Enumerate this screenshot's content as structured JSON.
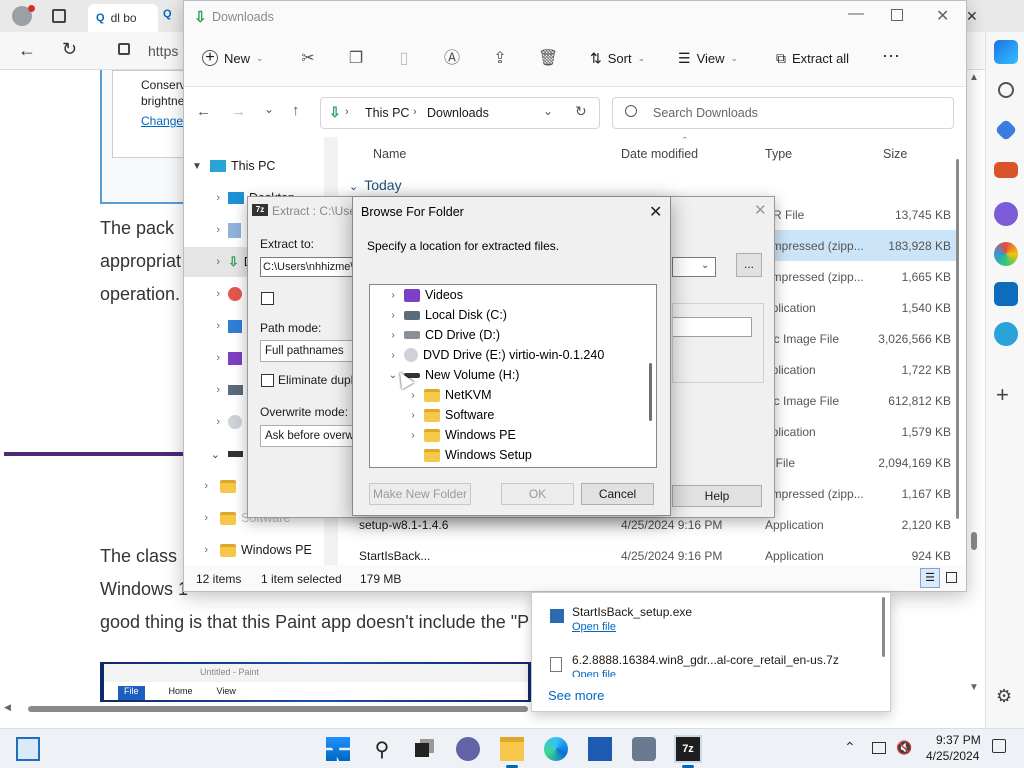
{
  "browser": {
    "tabs": [
      {
        "label": "dl bo"
      }
    ],
    "address": "https",
    "article": {
      "snippet_line1": "Conserv",
      "snippet_line2": "brightne",
      "snippet_link": "Change",
      "p1_line1": "The pack",
      "p1_line2": "appropriat",
      "p1_line3": "operation.",
      "p2_line1": "The class",
      "p2_line2": "Windows 1",
      "p2_line3": "good thing is that this Paint app doesn't include the \"P",
      "paint_title": "Untitled - Paint",
      "paint_tabs": [
        "File",
        "Home",
        "View"
      ]
    }
  },
  "explorer": {
    "title": "Downloads",
    "toolbar": {
      "new": "New",
      "sort": "Sort",
      "view": "View",
      "extract_all": "Extract all"
    },
    "breadcrumb": [
      "This PC",
      "Downloads"
    ],
    "search_placeholder": "Search Downloads",
    "nav": [
      {
        "label": "This PC"
      },
      {
        "label": "Desktop"
      },
      {
        "label": "D"
      },
      {
        "label": "D"
      },
      {
        "label": "M"
      },
      {
        "label": "P"
      },
      {
        "label": "V"
      },
      {
        "label": "L"
      },
      {
        "label": "D"
      },
      {
        "label": "N"
      },
      {
        "label": ""
      },
      {
        "label": "Software"
      },
      {
        "label": "Windows PE"
      }
    ],
    "columns": {
      "name": "Name",
      "date": "Date modified",
      "type": "Type",
      "size": "Size"
    },
    "group": "Today",
    "files": [
      {
        "name": "",
        "date": "",
        "type": "AR File",
        "size": "13,745 KB"
      },
      {
        "name": "",
        "date": "",
        "type": "ompressed (zipp...",
        "size": "183,928 KB"
      },
      {
        "name": "",
        "date": "",
        "type": "ompressed (zipp...",
        "size": "1,665 KB"
      },
      {
        "name": "",
        "date": "",
        "type": "pplication",
        "size": "1,540 KB"
      },
      {
        "name": "",
        "date": "",
        "type": "isc Image File",
        "size": "3,026,566 KB"
      },
      {
        "name": "",
        "date": "",
        "type": "pplication",
        "size": "1,722 KB"
      },
      {
        "name": "",
        "date": "",
        "type": "isc Image File",
        "size": "612,812 KB"
      },
      {
        "name": "",
        "date": "",
        "type": "pplication",
        "size": "1,579 KB"
      },
      {
        "name": "",
        "date": "",
        "type": "Z File",
        "size": "2,094,169 KB"
      },
      {
        "name": "",
        "date": "",
        "type": "ompressed (zipp...",
        "size": "1,167 KB"
      },
      {
        "name": "setup-w8.1-1.4.6",
        "date": "4/25/2024 9:16 PM",
        "type": "Application",
        "size": "2,120 KB"
      },
      {
        "name": "StartIsBack...",
        "date": "4/25/2024 9:16 PM",
        "type": "Application",
        "size": "924 KB"
      }
    ],
    "status": {
      "items": "12 items",
      "selected": "1 item selected",
      "size": "179 MB"
    }
  },
  "extract_dialog": {
    "title": "Extract : C:\\User",
    "extract_to_label": "Extract to:",
    "extract_to_value": "C:\\Users\\nhhizme\\",
    "browse_btn": "...",
    "path_mode_label": "Path mode:",
    "path_mode_value": "Full pathnames",
    "eliminate": "Eliminate duplica",
    "overwrite_label": "Overwrite mode:",
    "overwrite_value": "Ask before overwri",
    "help": "Help"
  },
  "browse_dialog": {
    "title": "Browse For Folder",
    "prompt": "Specify a location for extracted files.",
    "tree": [
      {
        "label": "Videos"
      },
      {
        "label": "Local Disk (C:)"
      },
      {
        "label": "CD Drive (D:)"
      },
      {
        "label": "DVD Drive (E:) virtio-win-0.1.240"
      },
      {
        "label": "New Volume (H:)"
      },
      {
        "label": "NetKVM"
      },
      {
        "label": "Software"
      },
      {
        "label": "Windows PE"
      },
      {
        "label": "Windows Setup"
      }
    ],
    "make_new": "Make New Folder",
    "ok": "OK",
    "cancel": "Cancel"
  },
  "downloads_flyout": {
    "item1": "StartIsBack_setup.exe",
    "item1_action": "Open file",
    "item2": "6.2.8888.16384.win8_gdr...al-core_retail_en-us.7z",
    "item2_action": "Open file",
    "see_more": "See more"
  },
  "taskbar": {
    "time": "9:37 PM",
    "date": "4/25/2024",
    "app_7z": "7z"
  },
  "colors": {
    "accent": "#0067c0",
    "folder": "#f5c84c",
    "selection": "#cce4f7",
    "article_purple": "#4b2a78"
  }
}
